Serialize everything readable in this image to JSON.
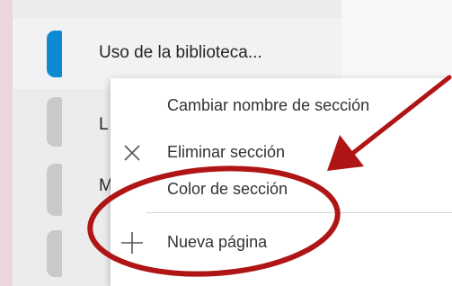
{
  "sections": [
    {
      "label": "Uso de la biblioteca...",
      "color": "#0d8bd2",
      "active": true
    },
    {
      "label": "L",
      "color": "#c9c9cb",
      "active": false
    },
    {
      "label": "M",
      "color": "#c9c9cb",
      "active": false
    },
    {
      "label": "",
      "color": "#c9c9cb",
      "active": false
    }
  ],
  "context_menu": {
    "items": [
      {
        "label": "Cambiar nombre de sección",
        "icon": "none"
      },
      {
        "label": "Eliminar sección",
        "icon": "close-icon"
      },
      {
        "label": "Color de sección",
        "icon": "none"
      },
      {
        "label": "Nueva página",
        "icon": "plus-icon"
      }
    ]
  },
  "annotation": {
    "color": "#b01515",
    "shapes": [
      "arrow",
      "ellipse"
    ]
  }
}
